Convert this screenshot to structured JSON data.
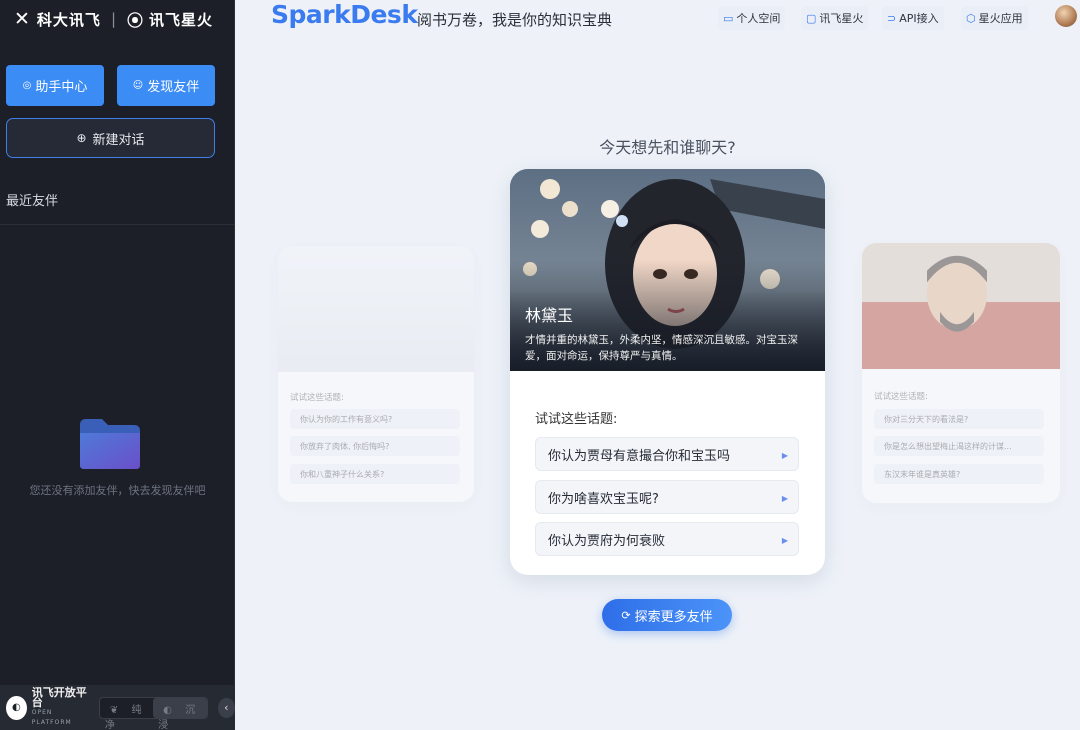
{
  "sidebar": {
    "brand_left": "科大讯飞",
    "brand_right": "讯飞星火",
    "assistant_center": "助手中心",
    "discover_partner": "发现友伴",
    "new_chat": "新建对话",
    "recent_title": "最近友伴",
    "empty_text": "您还没有添加友伴，快去发现友伴吧",
    "footer": {
      "platform_name": "讯飞开放平台",
      "platform_sub": "OPEN PLATFORM",
      "mode_plain": "纯净",
      "mode_immersive": "沉浸",
      "active_mode": "沉浸"
    }
  },
  "header": {
    "logo": "SparkDesk",
    "slogan": "阅书万卷，我是你的知识宝典",
    "links": [
      {
        "label": "个人空间",
        "icon": "folder-icon"
      },
      {
        "label": "讯飞星火",
        "icon": "monitor-icon"
      },
      {
        "label": "API接入",
        "icon": "api-icon"
      },
      {
        "label": "星火应用",
        "icon": "cube-icon"
      }
    ]
  },
  "main": {
    "question": "今天想先和谁聊天?",
    "featured": {
      "name": "林黛玉",
      "description": "才情并重的林黛玉，外柔内坚，情感深沉且敏感。对宝玉深爱，面对命运，保持尊严与真情。",
      "try_label": "试试这些话题:",
      "topics": [
        "你认为贾母有意撮合你和宝玉吗",
        "你为啥喜欢宝玉呢?",
        "你认为贾府为何衰败"
      ]
    },
    "left_card": {
      "try_label": "试试这些话题:",
      "topics": [
        "你认为你的工作有意义吗?",
        "你放弃了肉体, 你后悔吗?",
        "你和八重神子什么关系?"
      ]
    },
    "right_card": {
      "try_label": "试试这些话题:",
      "topics": [
        "你对三分天下的看法是?",
        "你是怎么想出望梅止渴这样的计谋...",
        "东汉末年谁是真英雄?"
      ]
    },
    "explore_button": "探索更多友伴"
  },
  "colors": {
    "accent": "#3b7bf0",
    "sidebar_bg": "#1c1f27",
    "page_bg": "#eef2f8"
  }
}
